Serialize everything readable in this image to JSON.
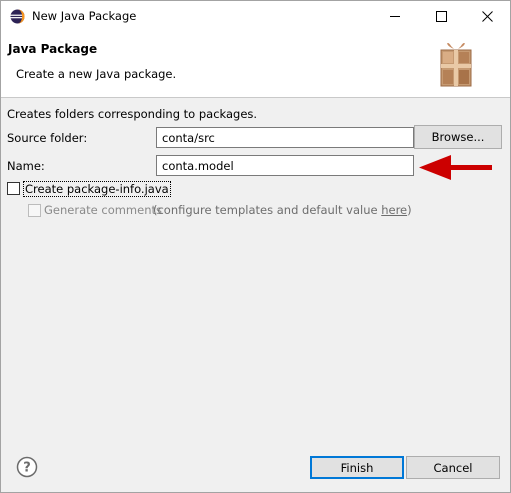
{
  "window": {
    "title": "New Java Package",
    "controls": {
      "minimize": "minimize-icon",
      "maximize": "maximize-icon",
      "close": "close-icon"
    }
  },
  "banner": {
    "title": "Java Package",
    "description": "Create a new Java package.",
    "icon": "package-gift-icon"
  },
  "form": {
    "intro": "Creates folders corresponding to packages.",
    "source_folder": {
      "label": "Source folder:",
      "value": "conta/src",
      "button": "Browse..."
    },
    "name": {
      "label": "Name:",
      "value": "conta.model"
    },
    "create_package_info": {
      "label": "Create package-info.java",
      "checked": false
    },
    "generate_comments": {
      "label": "Generate comments",
      "hint_prefix": "(configure templates and default value ",
      "hint_link": "here",
      "hint_suffix": ")",
      "checked": false,
      "enabled": false
    }
  },
  "annotation": {
    "arrow_color": "#cc0000"
  },
  "footer": {
    "help_icon": "help-icon",
    "finish": "Finish",
    "cancel": "Cancel"
  }
}
